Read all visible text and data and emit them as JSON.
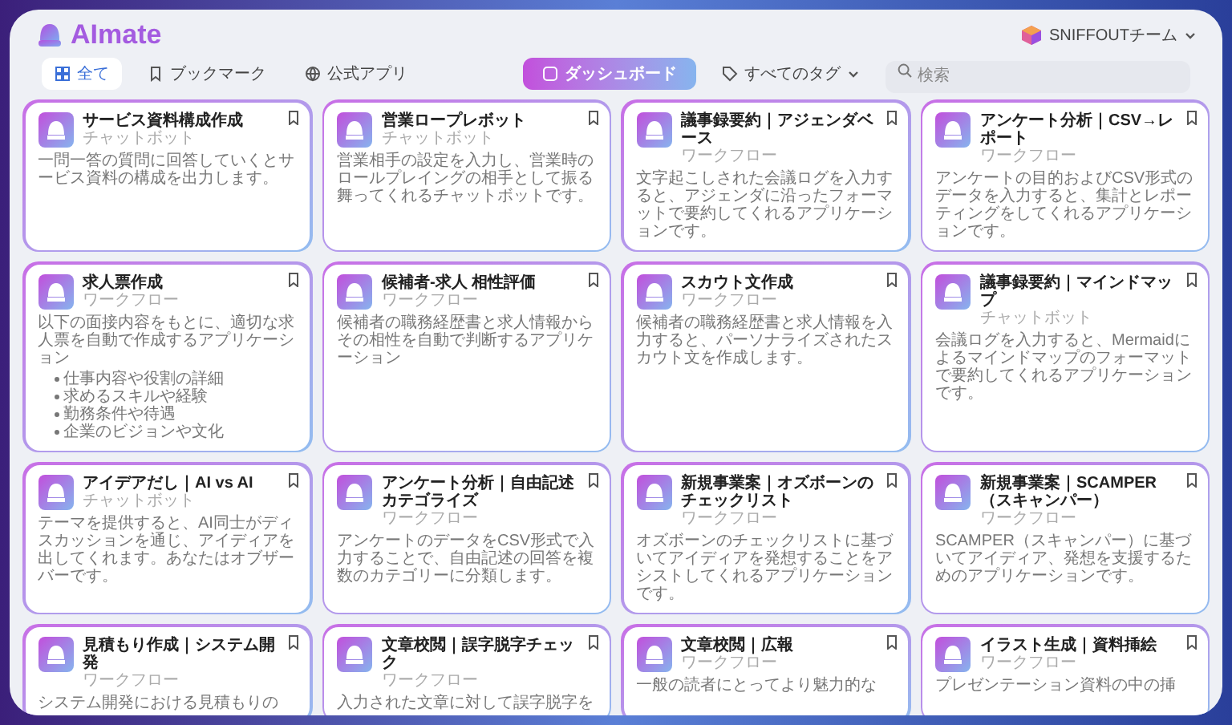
{
  "app": {
    "logo": "AImate",
    "team": "SNIFFOUTチーム"
  },
  "tabs": [
    {
      "label": "全て",
      "selected": true,
      "kind": "grid"
    },
    {
      "label": "ブックマーク",
      "selected": false,
      "kind": "bookmark"
    },
    {
      "label": "公式アプリ",
      "selected": false,
      "kind": "globe"
    }
  ],
  "toolbar": {
    "dashboard_button": "ダッシュボード",
    "tag_filter": "すべてのタグ",
    "search": {
      "placeholder": "検索"
    }
  },
  "cards": [
    {
      "title": "サービス資料構成作成",
      "type": "チャットボット",
      "description": "一問一答の質問に回答していくとサービス資料の構成を出力します。"
    },
    {
      "title": "営業ロープレボット",
      "type": "チャットボット",
      "description": "営業相手の設定を入力し、営業時のロールプレイングの相手として振る舞ってくれるチャットボットです。"
    },
    {
      "title": "議事録要約｜アジェンダベース",
      "type": "ワークフロー",
      "description": "文字起こしされた会議ログを入力すると、アジェンダに沿ったフォーマットで要約してくれるアプリケーションです。"
    },
    {
      "title": "アンケート分析｜CSV→レポート",
      "type": "ワークフロー",
      "description": "アンケートの目的およびCSV形式のデータを入力すると、集計とレポーティングをしてくれるアプリケーションです。"
    },
    {
      "title": "求人票作成",
      "type": "ワークフロー",
      "description": "以下の面接内容をもとに、適切な求人票を自動で作成するアプリケーション",
      "bullets": [
        "仕事内容や役割の詳細",
        "求めるスキルや経験",
        "勤務条件や待遇",
        "企業のビジョンや文化"
      ]
    },
    {
      "title": "候補者-求人 相性評価",
      "type": "ワークフロー",
      "description": "候補者の職務経歴書と求人情報からその相性を自動で判断するアプリケーション"
    },
    {
      "title": "スカウト文作成",
      "type": "ワークフロー",
      "description": "候補者の職務経歴書と求人情報を入力すると、パーソナライズされたスカウト文を作成します。"
    },
    {
      "title": "議事録要約｜マインドマップ",
      "type": "チャットボット",
      "description": "会議ログを入力すると、Mermaidによるマインドマップのフォーマットで要約してくれるアプリケーションです。"
    },
    {
      "title": "アイデアだし｜AI vs AI",
      "type": "チャットボット",
      "description": "テーマを提供すると、AI同士がディスカッションを通じ、アイディアを出してくれます。あなたはオブザーバーです。"
    },
    {
      "title": "アンケート分析｜自由記述カテゴライズ",
      "type": "ワークフロー",
      "description": "アンケートのデータをCSV形式で入力することで、自由記述の回答を複数のカテゴリーに分類します。"
    },
    {
      "title": "新規事業案｜オズボーンのチェックリスト",
      "type": "ワークフロー",
      "description": "オズボーンのチェックリストに基づいてアイディアを発想することをアシストしてくれるアプリケーションです。"
    },
    {
      "title": "新規事業案｜SCAMPER（スキャンパー）",
      "type": "ワークフロー",
      "description": "SCAMPER（スキャンパー）に基づいてアイディア、発想を支援するためのアプリケーションです。"
    },
    {
      "title": "見積もり作成｜システム開発",
      "type": "ワークフロー",
      "description": "システム開発における見積もりの"
    },
    {
      "title": "文章校閲｜誤字脱字チェック",
      "type": "ワークフロー",
      "description": "入力された文章に対して誤字脱字を"
    },
    {
      "title": "文章校閲｜広報",
      "type": "ワークフロー",
      "description": "一般の読者にとってより魅力的な"
    },
    {
      "title": "イラスト生成｜資料挿絵",
      "type": "ワークフロー",
      "description": "プレゼンテーション資料の中の挿"
    }
  ]
}
